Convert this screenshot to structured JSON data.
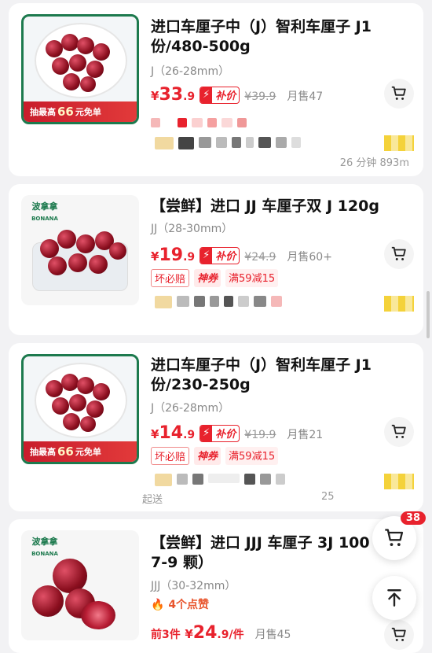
{
  "products": [
    {
      "title": "进口车厘子中（J）智利车厘子 J1份/480-500g",
      "spec": "J（26-28mm）",
      "price_currency": "¥",
      "price_int": "33",
      "price_dec": ".9",
      "subsidy_label": "补价",
      "orig_price": "¥39.9",
      "sold": "月售47",
      "promo": {
        "prefix": "抽最高",
        "amount": "66",
        "suffix": "元免单"
      },
      "distance_text": "26 分钟 893m"
    },
    {
      "title": "【尝鲜】进口 JJ 车厘子双 J 120g",
      "spec": "JJ（28-30mm）",
      "price_currency": "¥",
      "price_int": "19",
      "price_dec": ".9",
      "subsidy_label": "补价",
      "orig_price": "¥24.9",
      "sold": "月售60+",
      "tags": [
        "坏必赔",
        "神券",
        "满59减15"
      ],
      "brand": "波拿拿",
      "brand_en": "BONANA"
    },
    {
      "title": "进口车厘子中（J）智利车厘子 J1份/230-250g",
      "spec": "J（26-28mm）",
      "price_currency": "¥",
      "price_int": "14",
      "price_dec": ".9",
      "subsidy_label": "补价",
      "orig_price": "¥19.9",
      "sold": "月售21",
      "tags": [
        "坏必赔",
        "神券",
        "满59减15"
      ],
      "promo": {
        "prefix": "抽最高",
        "amount": "66",
        "suffix": "元免单"
      },
      "footer_left": "起送",
      "footer_right": "25"
    },
    {
      "title": "【尝鲜】进口 JJJ 车厘子 3J 100（约 7-9 颗）",
      "spec": "JJJ（30-32mm）",
      "likes": "4个点赞",
      "price_prefix": "前3件",
      "price_currency": "¥",
      "price_int": "24",
      "price_dec": ".9",
      "price_unit": "/件",
      "sold": "月售45",
      "brand": "波拿拿",
      "brand_en": "BONANA"
    }
  ],
  "cart_badge": "38",
  "icons": {
    "cart": "cart-icon",
    "top": "back-to-top-icon",
    "flame": "flame-icon",
    "bolt": "bolt-icon"
  },
  "colors": {
    "accent": "#e8222d",
    "brand_green": "#1d7a4e"
  }
}
